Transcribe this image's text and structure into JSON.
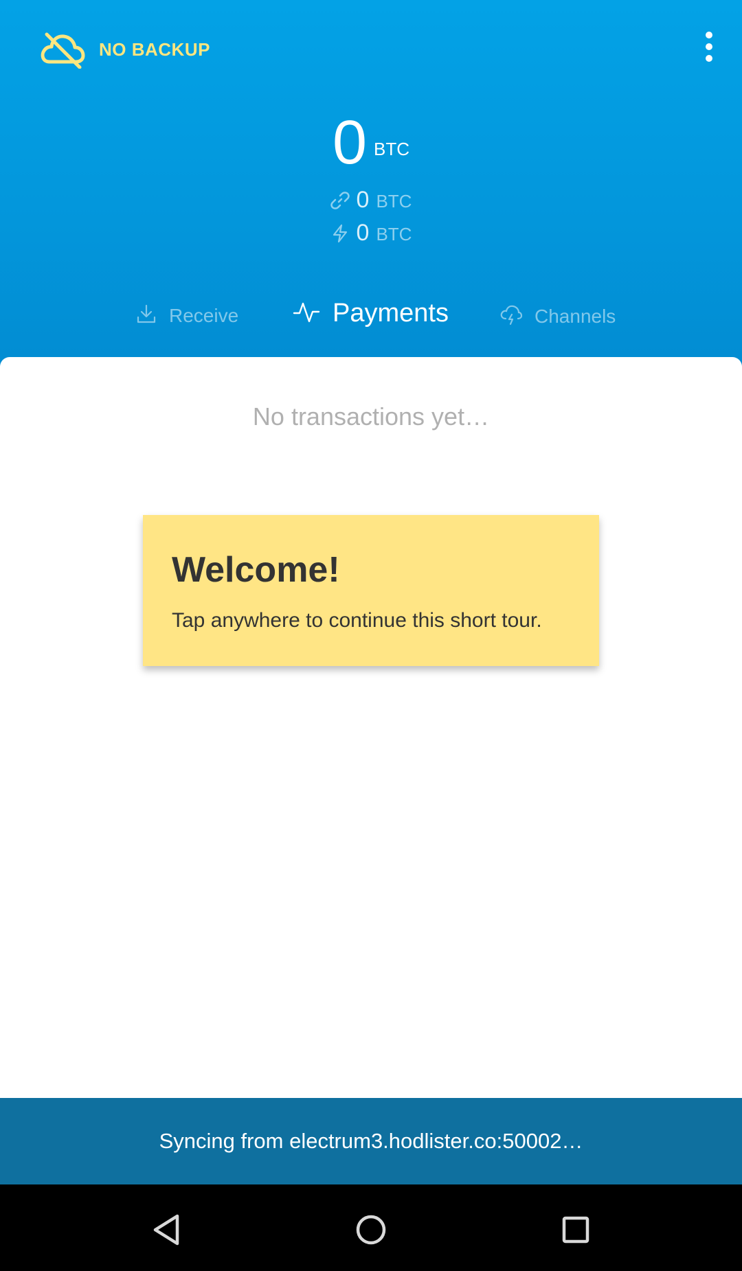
{
  "header": {
    "backup": {
      "label": "NO BACKUP",
      "icon": "cloud-off-icon",
      "color": "#fce680"
    },
    "menu": {
      "icon": "more-vert-icon"
    },
    "balance": {
      "total_amount": "0",
      "total_unit": "BTC",
      "onchain_amount": "0",
      "onchain_unit": "BTC",
      "lightning_amount": "0",
      "lightning_unit": "BTC"
    },
    "tabs": [
      {
        "label": "Receive",
        "icon": "download-icon",
        "active": false
      },
      {
        "label": "Payments",
        "icon": "activity-icon",
        "active": true
      },
      {
        "label": "Channels",
        "icon": "cloud-lightning-icon",
        "active": false
      }
    ],
    "accent": "#03a2e6"
  },
  "main": {
    "empty_message": "No transactions yet…",
    "tour": {
      "title": "Welcome!",
      "text": "Tap anywhere to continue this short tour.",
      "color": "#ffe585"
    }
  },
  "status": {
    "text": "Syncing from electrum3.hodlister.co:50002…",
    "color": "#0f709f"
  },
  "navbar": {
    "back_icon": "back-triangle-icon",
    "home_icon": "home-circle-icon",
    "recents_icon": "recents-square-icon"
  }
}
